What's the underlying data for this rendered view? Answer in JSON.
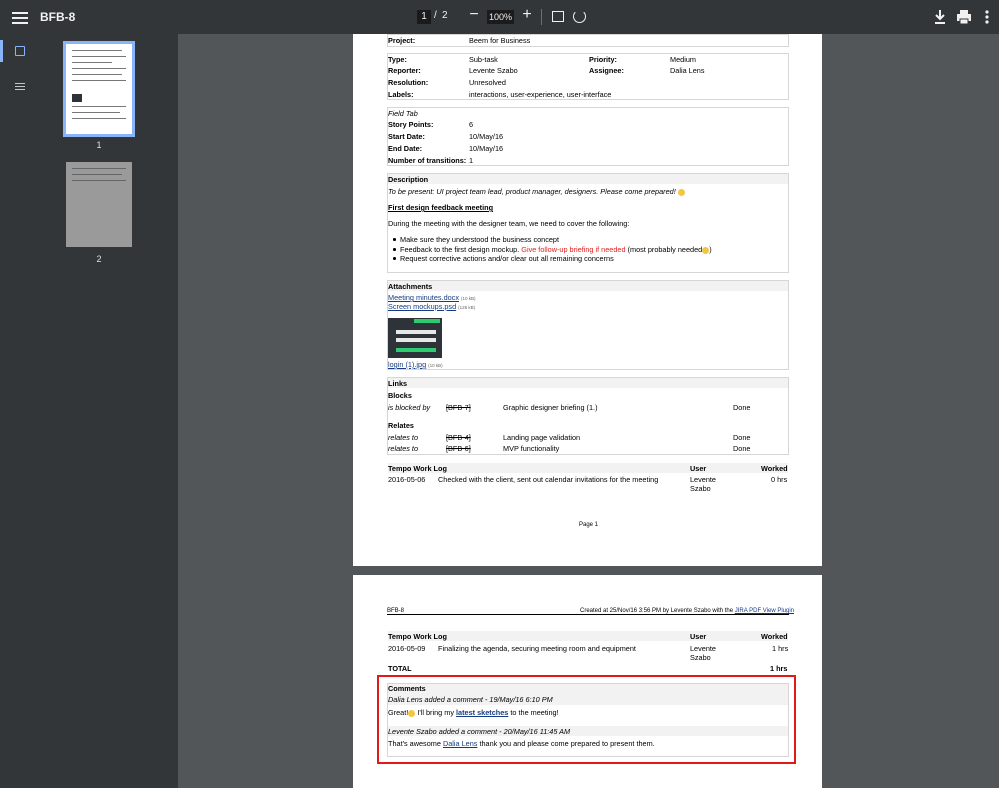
{
  "toolbar": {
    "title": "BFB-8",
    "page_current": "1",
    "page_sep": "/",
    "page_total": "2",
    "zoom": "100%",
    "minus": "−",
    "plus": "+"
  },
  "thumbnails": [
    {
      "label": "1"
    },
    {
      "label": "2"
    }
  ],
  "page1": {
    "project_label": "Project:",
    "project_value": "Beem for Business",
    "type_label": "Type:",
    "type_value": "Sub-task",
    "priority_label": "Priority:",
    "priority_value": "Medium",
    "reporter_label": "Reporter:",
    "reporter_value": "Levente Szabo",
    "assignee_label": "Assignee:",
    "assignee_value": "Dalia Lens",
    "resolution_label": "Resolution:",
    "resolution_value": "Unresolved",
    "labels_label": "Labels:",
    "labels_value": "interactions, user-experience, user-interface",
    "field_tab": "Field Tab",
    "story_points_label": "Story Points:",
    "story_points_value": "6",
    "start_label": "Start Date:",
    "start_value": "10/May/16",
    "end_label": "End Date:",
    "end_value": "10/May/16",
    "transitions_label": "Number of transitions:",
    "transitions_value": "1",
    "description_head": "Description",
    "description_intro": "To be present: UI project team lead, product manager, designers. Please come prepared!",
    "meeting_heading": "First design feedback meeting",
    "meeting_text": "During the meeting with the designer team, we need to cover the following:",
    "bullet1": "Make sure they understood the business concept",
    "bullet2_a": "Feedback to the first design mockup.",
    "bullet2_b": "Give follow-up briefing if needed",
    "bullet2_c": "(most probably needed",
    "bullet2_d": ")",
    "bullet3": "Request corrective actions and/or clear out all remaining concerns",
    "attachments_head": "Attachments",
    "att1_name": "Meeting minutes.docx",
    "att1_size": "(10 kB)",
    "att2_name": "Screen mockups.psd",
    "att2_size": "(128 kB)",
    "att3_name": "login (1).jpg",
    "att3_size": "(10 kB)",
    "links_head": "Links",
    "blocks_head": "Blocks",
    "link1_rel": "is blocked by",
    "link1_key": "[BFB-7]",
    "link1_title": "Graphic designer briefing (1.)",
    "link1_status": "Done",
    "relates_head": "Relates",
    "link2_rel": "relates to",
    "link2_key": "[BFB-4]",
    "link2_title": "Landing page validation",
    "link2_status": "Done",
    "link3_rel": "relates to",
    "link3_key": "[BFB-6]",
    "link3_title": "MVP functionality",
    "link3_status": "Done",
    "tempo_head": "Tempo Work Log",
    "tempo_user": "User",
    "tempo_worked": "Worked",
    "tempo1_date": "2016-05-06",
    "tempo1_desc": "Checked with the client, sent out calendar invitations for the meeting",
    "tempo1_user_a": "Levente",
    "tempo1_user_b": "Szabo",
    "tempo1_hours": "0 hrs",
    "page_footer": "Page 1"
  },
  "page2": {
    "header_left": "BFB-8",
    "header_right_text": "Created at 25/Nov/16 3:56 PM by Levente Szabo with the",
    "header_right_link": "JIRA PDF View Plugin",
    "tempo_head": "Tempo Work Log",
    "tempo_user": "User",
    "tempo_worked": "Worked",
    "tempo2_date": "2016-05-09",
    "tempo2_desc": "Finalizing the agenda, securing meeting room and equipment",
    "tempo2_user_a": "Levente",
    "tempo2_user_b": "Szabo",
    "tempo2_hours": "1 hrs",
    "total_label": "TOTAL",
    "total_hours": "1 hrs",
    "comments_head": "Comments",
    "c1_meta": "Dalia Lens added a comment - 19/May/16 6:10 PM",
    "c1_a": "Great!",
    "c1_b": "I'll bring my",
    "c1_link": "latest sketches",
    "c1_c": "to the meeting!",
    "c2_meta": "Levente Szabo added a comment - 20/May/16 11:45 AM",
    "c2_a": "That's awesome",
    "c2_link": "Dalia Lens",
    "c2_b": "thank you and please come prepared to present them."
  },
  "colors": {
    "toolbar": "#323639",
    "viewer_bg": "#525659",
    "highlight": "#e0191b",
    "link": "#153c83",
    "red_text": "#e02020"
  },
  "icons": [
    "menu-icon",
    "fit-page-icon",
    "rotate-icon",
    "download-icon",
    "print-icon",
    "more-icon",
    "thumbnail-view-icon",
    "outline-view-icon"
  ]
}
